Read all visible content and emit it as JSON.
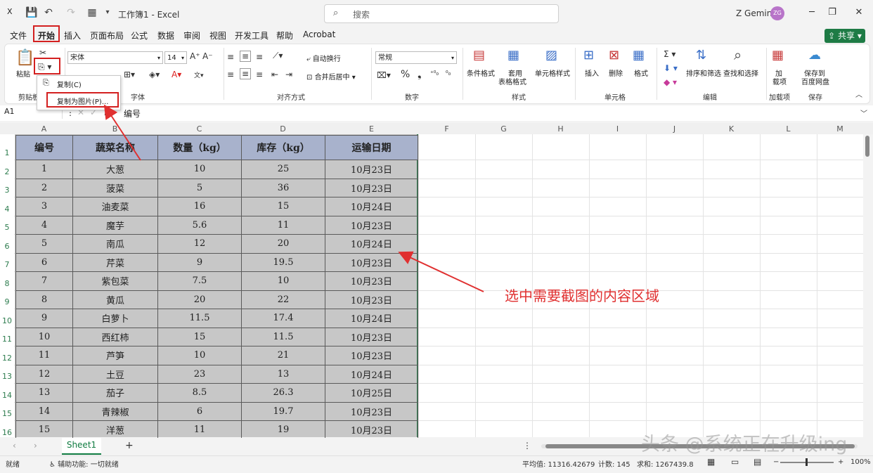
{
  "titlebar": {
    "app_icon": "excel-icon",
    "title": "工作簿1 - Excel",
    "search_placeholder": "搜索",
    "user_name": "Z Gemini",
    "avatar_initials": "ZG"
  },
  "tabs": [
    "文件",
    "开始",
    "插入",
    "页面布局",
    "公式",
    "数据",
    "审阅",
    "视图",
    "开发工具",
    "帮助",
    "Acrobat"
  ],
  "share_label": "共享",
  "ribbon": {
    "paste_label": "粘贴",
    "clipboard_group": "剪贴板",
    "font_name": "宋体",
    "font_size": "14",
    "font_group": "字体",
    "wrap_text": "自动换行",
    "merge_center": "合并后居中",
    "align_group": "对齐方式",
    "number_format": "常规",
    "number_group": "数字",
    "cond_format": "条件格式",
    "table_format_1": "套用",
    "table_format_2": "表格格式",
    "cell_styles": "单元格样式",
    "styles_group": "样式",
    "insert": "插入",
    "delete": "删除",
    "format": "格式",
    "cells_group": "单元格",
    "sort_filter": "排序和筛选",
    "find_select": "查找和选择",
    "edit_group": "编辑",
    "addins_1": "加",
    "addins_2": "载项",
    "addins_group": "加载项",
    "save_baidu_1": "保存到",
    "save_baidu_2": "百度网盘",
    "save_group": "保存"
  },
  "copy_menu": {
    "item1": "复制(C)",
    "item2": "复制为图片(P)..."
  },
  "formula_bar": {
    "name_box": "A1",
    "content": "编号"
  },
  "columns": [
    "A",
    "B",
    "C",
    "D",
    "E",
    "F",
    "G",
    "H",
    "I",
    "J",
    "K",
    "L",
    "M"
  ],
  "row_numbers": [
    "1",
    "2",
    "3",
    "4",
    "5",
    "6",
    "7",
    "8",
    "9",
    "10",
    "11",
    "12",
    "13",
    "14",
    "15",
    "16"
  ],
  "table": {
    "headers": [
      "编号",
      "蔬菜名称",
      "数量（kg）",
      "库存（kg）",
      "运输日期"
    ],
    "rows": [
      [
        "1",
        "大葱",
        "10",
        "25",
        "10月23日"
      ],
      [
        "2",
        "菠菜",
        "5",
        "36",
        "10月23日"
      ],
      [
        "3",
        "油麦菜",
        "16",
        "15",
        "10月24日"
      ],
      [
        "4",
        "魔芋",
        "5.6",
        "11",
        "10月23日"
      ],
      [
        "5",
        "南瓜",
        "12",
        "20",
        "10月24日"
      ],
      [
        "6",
        "芹菜",
        "9",
        "19.5",
        "10月23日"
      ],
      [
        "7",
        "紫包菜",
        "7.5",
        "10",
        "10月23日"
      ],
      [
        "8",
        "黄瓜",
        "20",
        "22",
        "10月23日"
      ],
      [
        "9",
        "白萝卜",
        "11.5",
        "17.4",
        "10月24日"
      ],
      [
        "10",
        "西红柿",
        "15",
        "11.5",
        "10月23日"
      ],
      [
        "11",
        "芦笋",
        "10",
        "21",
        "10月23日"
      ],
      [
        "12",
        "土豆",
        "23",
        "13",
        "10月24日"
      ],
      [
        "13",
        "茄子",
        "8.5",
        "26.3",
        "10月25日"
      ],
      [
        "14",
        "青辣椒",
        "6",
        "19.7",
        "10月23日"
      ],
      [
        "15",
        "洋葱",
        "11",
        "19",
        "10月23日"
      ]
    ]
  },
  "sheet_tab": "Sheet1",
  "status": {
    "ready": "就绪",
    "accessibility": "辅助功能: 一切就绪",
    "average": "平均值: 11316.42679",
    "count": "计数: 145",
    "sum": "求和: 1267439.8",
    "zoom": "100%"
  },
  "annotation": "选中需要截图的内容区域",
  "watermark": "头条 @系统正在升级ing",
  "colors": {
    "excel_green": "#107c41",
    "annotation_red": "#e03030",
    "header_fill": "#a8b2cc"
  }
}
